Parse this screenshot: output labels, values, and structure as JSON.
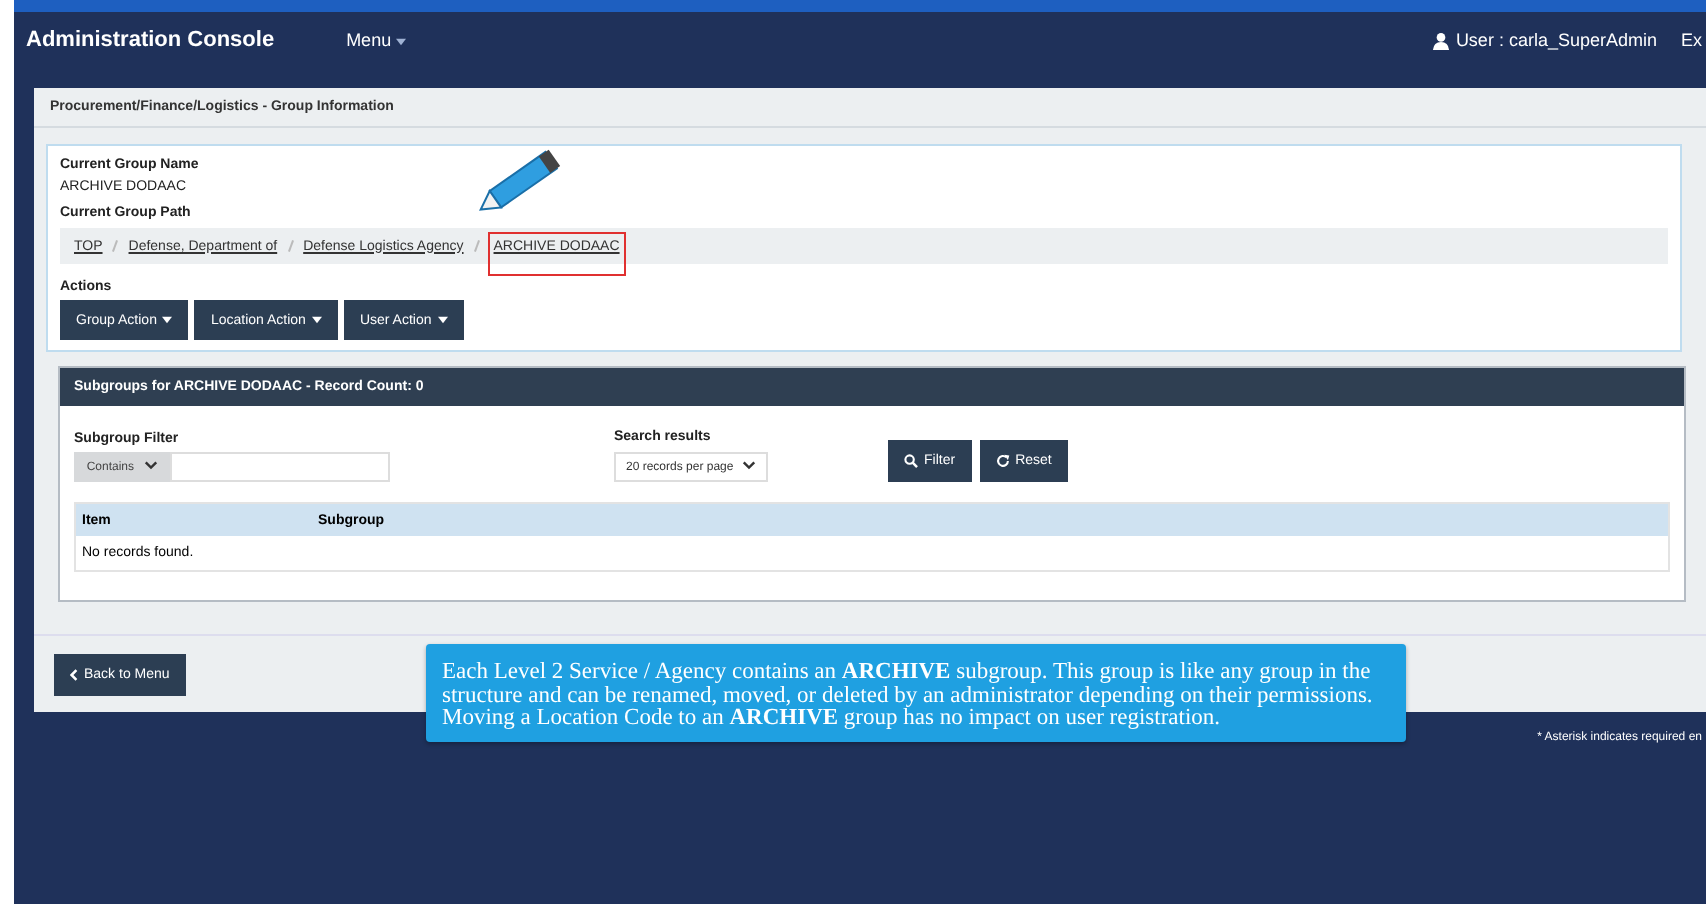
{
  "header": {
    "title": "Administration Console",
    "menu": "Menu",
    "user": "User : carla_SuperAdmin",
    "exit": "Ex"
  },
  "panel_title": "Procurement/Finance/Logistics - Group Information",
  "group": {
    "name_label": "Current Group Name",
    "name": "ARCHIVE DODAAC",
    "path_label": "Current Group Path",
    "path": [
      {
        "label": "TOP",
        "highlighted": false
      },
      {
        "label": "Defense, Department of",
        "highlighted": false
      },
      {
        "label": "Defense Logistics Agency",
        "highlighted": false
      },
      {
        "label": "ARCHIVE DODAAC",
        "highlighted": true
      }
    ],
    "actions_label": "Actions",
    "actions": [
      "Group Action",
      "Location Action",
      "User Action"
    ]
  },
  "subgroups": {
    "title": "Subgroups for ARCHIVE DODAAC - Record Count: 0",
    "filter_label": "Subgroup Filter",
    "filter_mode": "Contains",
    "results_label": "Search results",
    "per_page": "20 records per page",
    "filter_button": "Filter",
    "reset_button": "Reset",
    "columns": [
      "Item",
      "Subgroup"
    ],
    "empty": "No records found."
  },
  "back_button": "Back to Menu",
  "footnote": "* Asterisk indicates required en",
  "tooltip": "Each Level 2 Service / Agency contains an **ARCHIVE** subgroup. This group is like any group in the structure and can be renamed, moved, or deleted by an administrator depending on their permissions.  Moving a Location Code to an **ARCHIVE** group has no impact on user registration."
}
